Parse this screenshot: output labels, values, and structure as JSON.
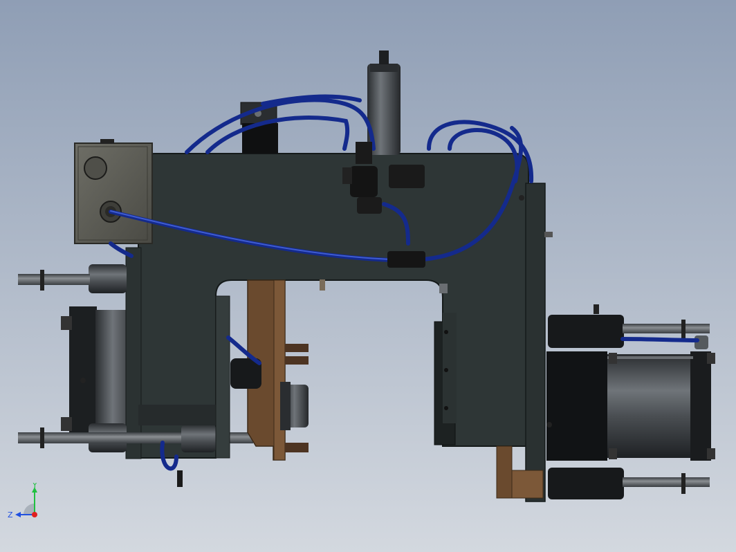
{
  "viewport": {
    "background_top": "#8F9EB5",
    "background_bottom": "#D3D8DF"
  },
  "model": {
    "colors": {
      "plate": "#2E3636",
      "plate_edge": "#1A1F1F",
      "tube": "#142A8C",
      "tube_highlight": "#3F5CD0",
      "steel": "#4A4E52",
      "steel_light": "#7A7E82",
      "rod": "#6B7074",
      "bronze": "#6A4A2E",
      "bronze_light": "#8C6642",
      "box": "#5C5C55",
      "cylinder_body": "#505458",
      "black": "#141414"
    }
  },
  "triad": {
    "y_label": "Y",
    "z_label": "Z",
    "x_color": "#E02020",
    "y_color": "#20C040",
    "z_color": "#2050E0"
  }
}
